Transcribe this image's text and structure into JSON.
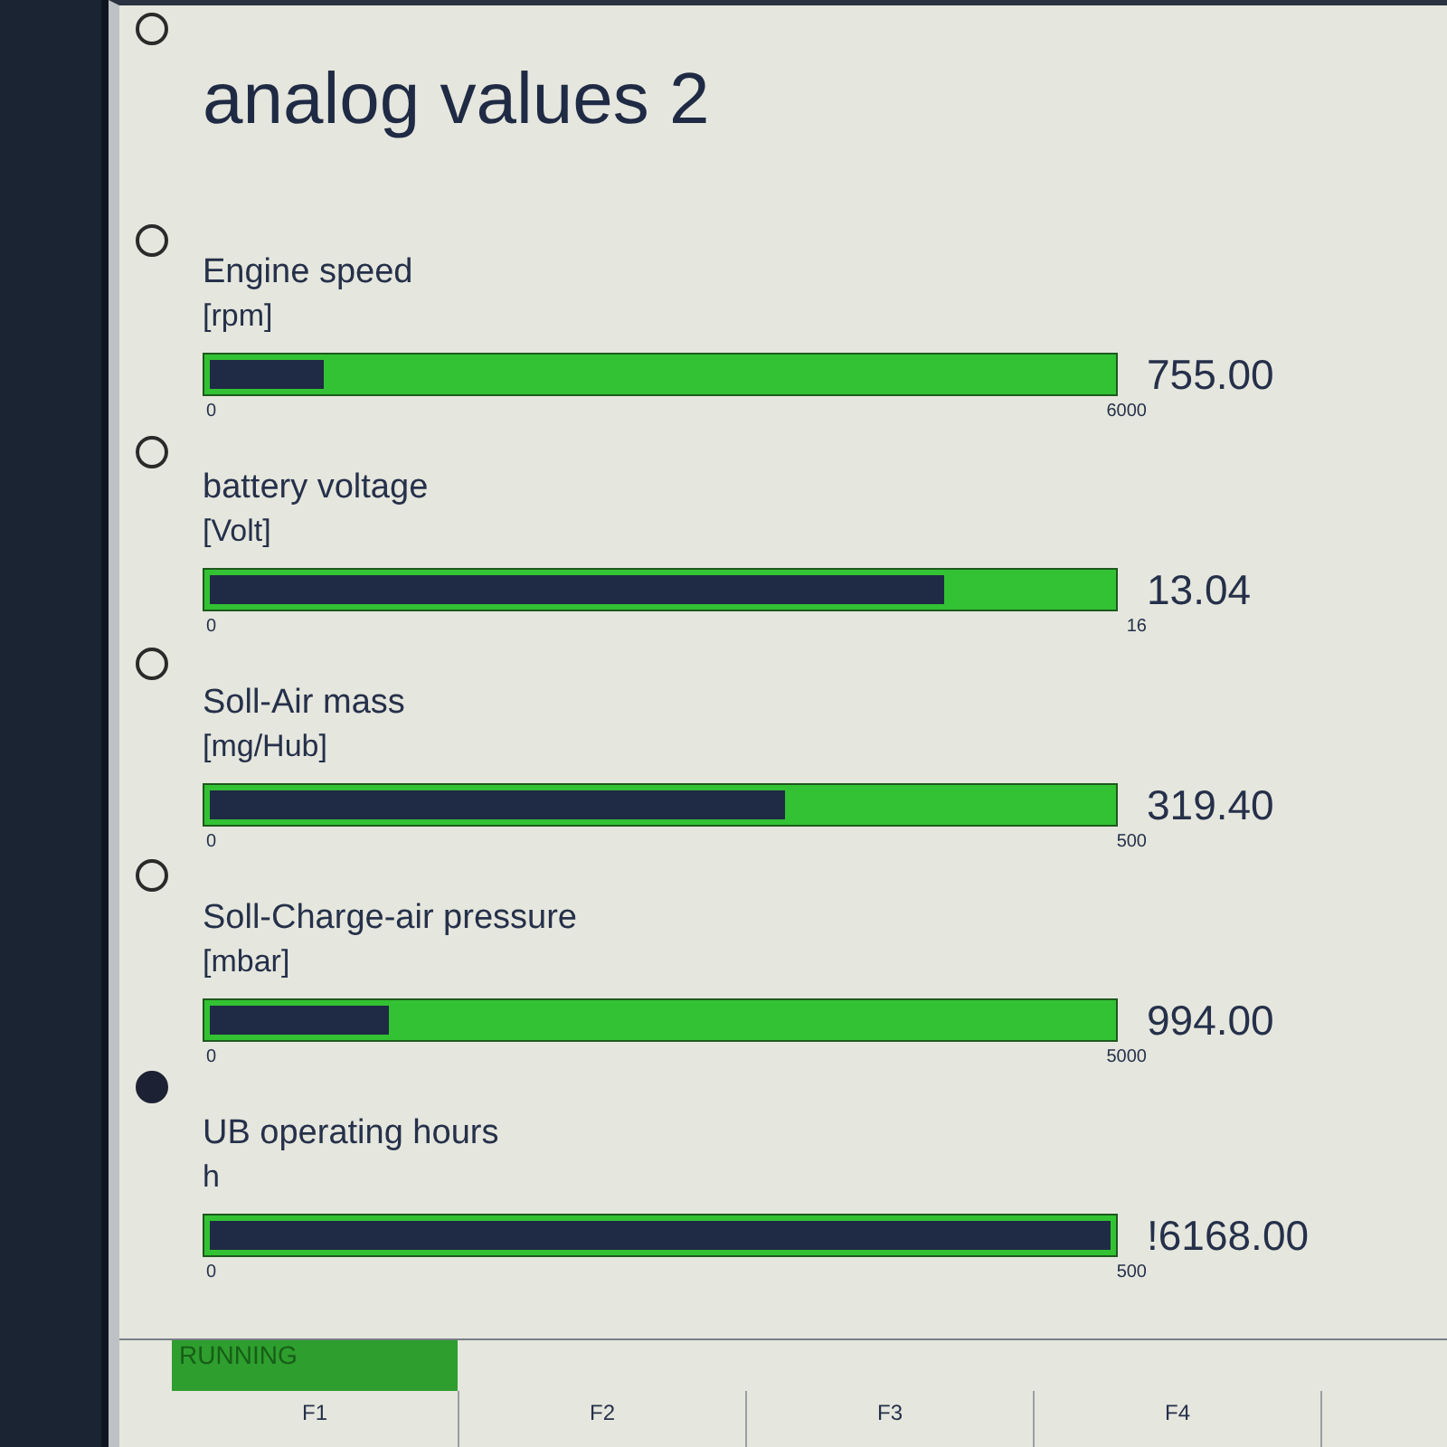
{
  "screen": {
    "title": "analog values 2",
    "page_markers": [
      {
        "selected": false
      },
      {
        "selected": false
      },
      {
        "selected": false
      },
      {
        "selected": false
      },
      {
        "selected": false
      },
      {
        "selected": true
      }
    ],
    "gauges": [
      {
        "name": "Engine speed",
        "unit": "[rpm]",
        "level": 0.126,
        "min": "0",
        "max": "6000",
        "value": "755.00"
      },
      {
        "name": "battery voltage",
        "unit": "[Volt]",
        "level": 0.815,
        "min": "0",
        "max": "16",
        "value": "13.04"
      },
      {
        "name": "Soll-Air mass",
        "unit": "[mg/Hub]",
        "level": 0.639,
        "min": "0",
        "max": "500",
        "value": "319.40"
      },
      {
        "name": "Soll-Charge-air pressure",
        "unit": "[mbar]",
        "level": 0.199,
        "min": "0",
        "max": "5000",
        "value": "994.00"
      },
      {
        "name": "UB operating hours",
        "unit": "h",
        "level": 1,
        "min": "0",
        "max": "500",
        "value": "!6168.00"
      }
    ],
    "status": {
      "text": "RUNNING"
    },
    "function_keys": [
      "F1",
      "F2",
      "F3",
      "F4"
    ]
  }
}
